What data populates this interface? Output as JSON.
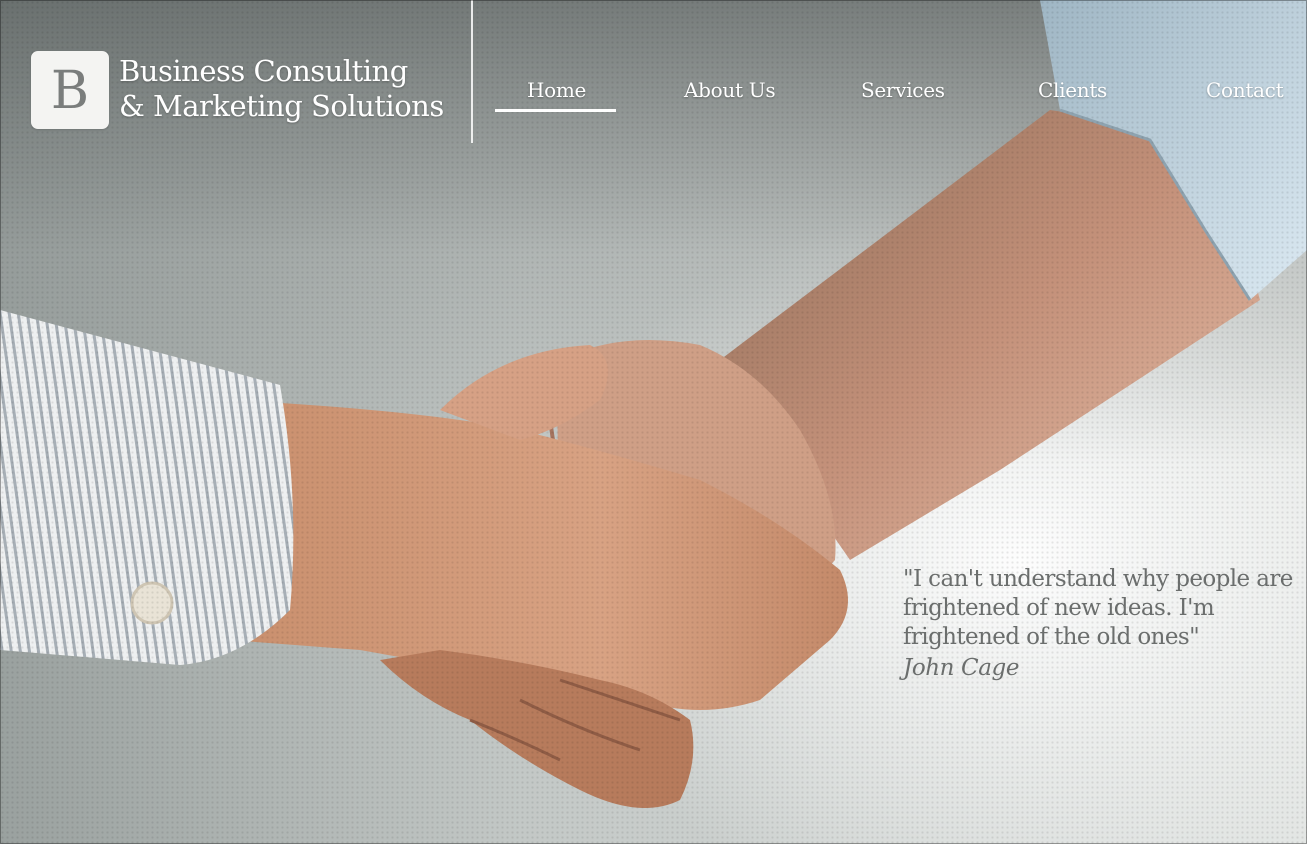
{
  "brand": {
    "logo_letter": "B",
    "line1": "Business Consulting",
    "line2": "& Marketing Solutions"
  },
  "nav": {
    "items": [
      {
        "label": "Home",
        "active": true
      },
      {
        "label": "About Us",
        "active": false
      },
      {
        "label": "Services",
        "active": false
      },
      {
        "label": "Clients",
        "active": false
      },
      {
        "label": "Contact",
        "active": false
      }
    ]
  },
  "hero": {
    "image": "handshake-photo",
    "quote": "\"I can't understand why people are frightened of new ideas. I'm frightened of the old ones\"",
    "author": "John Cage"
  },
  "colors": {
    "nav_text": "#ffffff",
    "quote_text": "#6b6e6d",
    "logo_bg": "#f4f4f2"
  }
}
